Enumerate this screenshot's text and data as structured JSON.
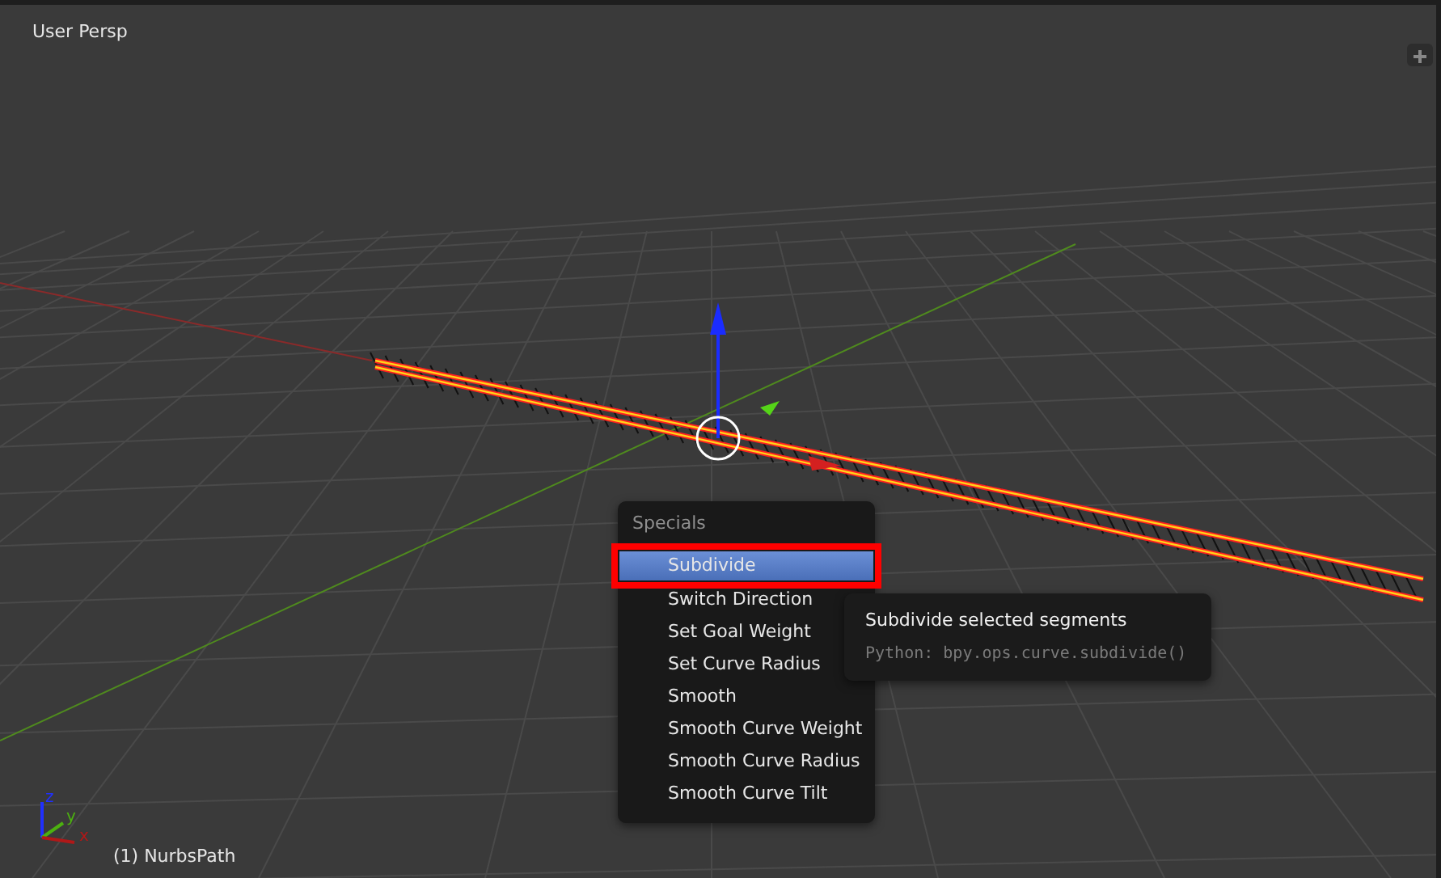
{
  "viewport": {
    "view_label": "User Persp",
    "object_label": "(1) NurbsPath"
  },
  "orientation_axes": [
    {
      "kind": "z",
      "label": "z"
    },
    {
      "kind": "y",
      "label": "y"
    },
    {
      "kind": "x",
      "label": "x"
    }
  ],
  "menu": {
    "title": "Specials",
    "items": [
      {
        "label": "Subdivide",
        "selected": true
      },
      {
        "label": "Switch Direction",
        "selected": false
      },
      {
        "label": "Set Goal Weight",
        "selected": false
      },
      {
        "label": "Set Curve Radius",
        "selected": false
      },
      {
        "label": "Smooth",
        "selected": false
      },
      {
        "label": "Smooth Curve Weight",
        "selected": false
      },
      {
        "label": "Smooth Curve Radius",
        "selected": false
      },
      {
        "label": "Smooth Curve Tilt",
        "selected": false
      }
    ]
  },
  "tooltip": {
    "title": "Subdivide selected segments",
    "python": "Python: bpy.ops.curve.subdivide()"
  }
}
